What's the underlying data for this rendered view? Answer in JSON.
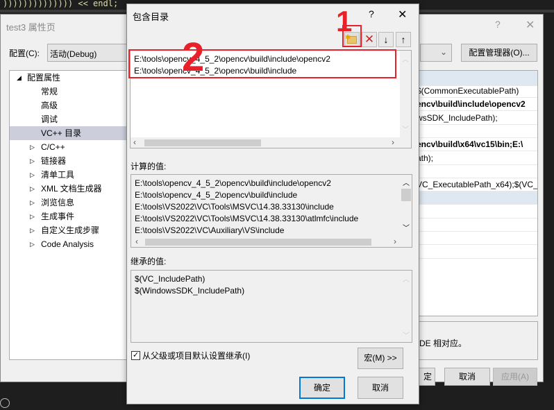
{
  "background_code": "))))))))))))))     << endl;",
  "prop_dialog": {
    "title": "test3 属性页",
    "help": "?",
    "close": "✕",
    "config_label": "配置(C):",
    "config_value": "活动(Debug)",
    "config_manager": "配置管理器(O)...",
    "tree": [
      {
        "label": "配置属性",
        "expander": "◢",
        "level": 0
      },
      {
        "label": "常规",
        "level": 1
      },
      {
        "label": "高级",
        "level": 1
      },
      {
        "label": "调试",
        "level": 1
      },
      {
        "label": "VC++ 目录",
        "level": 1,
        "selected": true
      },
      {
        "label": "C/C++",
        "expander": "▷",
        "level": 1
      },
      {
        "label": "链接器",
        "expander": "▷",
        "level": 1
      },
      {
        "label": "清单工具",
        "expander": "▷",
        "level": 1
      },
      {
        "label": "XML 文档生成器",
        "expander": "▷",
        "level": 1
      },
      {
        "label": "浏览信息",
        "expander": "▷",
        "level": 1
      },
      {
        "label": "生成事件",
        "expander": "▷",
        "level": 1
      },
      {
        "label": "自定义生成步骤",
        "expander": "▷",
        "level": 1
      },
      {
        "label": "Code Analysis",
        "expander": "▷",
        "level": 1
      }
    ],
    "rows": [
      {
        "text": "",
        "bold": false,
        "header": true
      },
      {
        "text": "$(CommonExecutablePath)",
        "bold": false
      },
      {
        "text": "encv\\build\\include\\opencv2",
        "bold": true
      },
      {
        "text": "wsSDK_IncludePath);",
        "bold": false
      },
      {
        "text": "",
        "bold": false
      },
      {
        "text": "encv\\build\\x64\\vc15\\bin;E:\\",
        "bold": true
      },
      {
        "text": "ath);",
        "bold": false
      },
      {
        "text": "",
        "bold": false
      },
      {
        "text": "VC_ExecutablePath_x64);$(VC_",
        "bold": false
      }
    ],
    "description": "DE 相对应。",
    "ok": "定",
    "cancel": "取消",
    "apply": "应用(A)"
  },
  "include_dialog": {
    "title": "包含目录",
    "help": "?",
    "close": "✕",
    "toolbar": {
      "new_icon": "new-folder-icon",
      "delete_icon": "delete-icon",
      "down_icon": "arrow-down-icon",
      "up_icon": "arrow-up-icon"
    },
    "entries": [
      "E:\\tools\\opencv_4_5_2\\opencv\\build\\include\\opencv2",
      "E:\\tools\\opencv_4_5_2\\opencv\\build\\include"
    ],
    "computed_label": "计算的值:",
    "computed": [
      "E:\\tools\\opencv_4_5_2\\opencv\\build\\include\\opencv2",
      "E:\\tools\\opencv_4_5_2\\opencv\\build\\include",
      "E:\\tools\\VS2022\\VC\\Tools\\MSVC\\14.38.33130\\include",
      "E:\\tools\\VS2022\\VC\\Tools\\MSVC\\14.38.33130\\atlmfc\\include",
      "E:\\tools\\VS2022\\VC\\Auxiliary\\VS\\include"
    ],
    "inherited_label": "继承的值:",
    "inherited": [
      "$(VC_IncludePath)",
      "$(WindowsSDK_IncludePath)"
    ],
    "inherit_checkbox": "从父级或项目默认设置继承(I)",
    "inherit_checked": true,
    "macros": "宏(M) >>",
    "ok": "确定",
    "cancel": "取消"
  },
  "annotations": {
    "step1": "1",
    "step2": "2",
    "color": "#e8202a"
  }
}
